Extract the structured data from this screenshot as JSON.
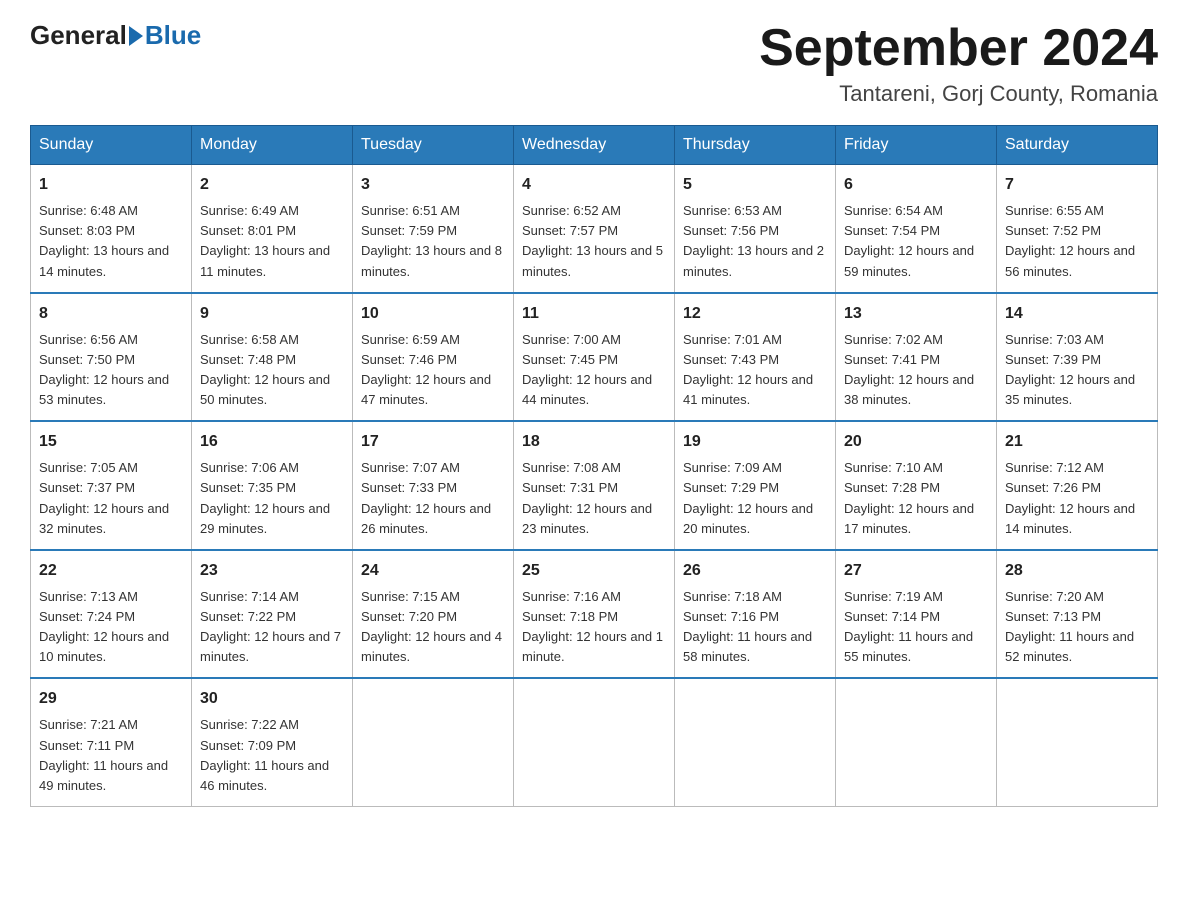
{
  "logo": {
    "general": "General",
    "blue": "Blue"
  },
  "title": "September 2024",
  "location": "Tantareni, Gorj County, Romania",
  "days_of_week": [
    "Sunday",
    "Monday",
    "Tuesday",
    "Wednesday",
    "Thursday",
    "Friday",
    "Saturday"
  ],
  "weeks": [
    [
      {
        "day": "1",
        "sunrise": "6:48 AM",
        "sunset": "8:03 PM",
        "daylight": "13 hours and 14 minutes."
      },
      {
        "day": "2",
        "sunrise": "6:49 AM",
        "sunset": "8:01 PM",
        "daylight": "13 hours and 11 minutes."
      },
      {
        "day": "3",
        "sunrise": "6:51 AM",
        "sunset": "7:59 PM",
        "daylight": "13 hours and 8 minutes."
      },
      {
        "day": "4",
        "sunrise": "6:52 AM",
        "sunset": "7:57 PM",
        "daylight": "13 hours and 5 minutes."
      },
      {
        "day": "5",
        "sunrise": "6:53 AM",
        "sunset": "7:56 PM",
        "daylight": "13 hours and 2 minutes."
      },
      {
        "day": "6",
        "sunrise": "6:54 AM",
        "sunset": "7:54 PM",
        "daylight": "12 hours and 59 minutes."
      },
      {
        "day": "7",
        "sunrise": "6:55 AM",
        "sunset": "7:52 PM",
        "daylight": "12 hours and 56 minutes."
      }
    ],
    [
      {
        "day": "8",
        "sunrise": "6:56 AM",
        "sunset": "7:50 PM",
        "daylight": "12 hours and 53 minutes."
      },
      {
        "day": "9",
        "sunrise": "6:58 AM",
        "sunset": "7:48 PM",
        "daylight": "12 hours and 50 minutes."
      },
      {
        "day": "10",
        "sunrise": "6:59 AM",
        "sunset": "7:46 PM",
        "daylight": "12 hours and 47 minutes."
      },
      {
        "day": "11",
        "sunrise": "7:00 AM",
        "sunset": "7:45 PM",
        "daylight": "12 hours and 44 minutes."
      },
      {
        "day": "12",
        "sunrise": "7:01 AM",
        "sunset": "7:43 PM",
        "daylight": "12 hours and 41 minutes."
      },
      {
        "day": "13",
        "sunrise": "7:02 AM",
        "sunset": "7:41 PM",
        "daylight": "12 hours and 38 minutes."
      },
      {
        "day": "14",
        "sunrise": "7:03 AM",
        "sunset": "7:39 PM",
        "daylight": "12 hours and 35 minutes."
      }
    ],
    [
      {
        "day": "15",
        "sunrise": "7:05 AM",
        "sunset": "7:37 PM",
        "daylight": "12 hours and 32 minutes."
      },
      {
        "day": "16",
        "sunrise": "7:06 AM",
        "sunset": "7:35 PM",
        "daylight": "12 hours and 29 minutes."
      },
      {
        "day": "17",
        "sunrise": "7:07 AM",
        "sunset": "7:33 PM",
        "daylight": "12 hours and 26 minutes."
      },
      {
        "day": "18",
        "sunrise": "7:08 AM",
        "sunset": "7:31 PM",
        "daylight": "12 hours and 23 minutes."
      },
      {
        "day": "19",
        "sunrise": "7:09 AM",
        "sunset": "7:29 PM",
        "daylight": "12 hours and 20 minutes."
      },
      {
        "day": "20",
        "sunrise": "7:10 AM",
        "sunset": "7:28 PM",
        "daylight": "12 hours and 17 minutes."
      },
      {
        "day": "21",
        "sunrise": "7:12 AM",
        "sunset": "7:26 PM",
        "daylight": "12 hours and 14 minutes."
      }
    ],
    [
      {
        "day": "22",
        "sunrise": "7:13 AM",
        "sunset": "7:24 PM",
        "daylight": "12 hours and 10 minutes."
      },
      {
        "day": "23",
        "sunrise": "7:14 AM",
        "sunset": "7:22 PM",
        "daylight": "12 hours and 7 minutes."
      },
      {
        "day": "24",
        "sunrise": "7:15 AM",
        "sunset": "7:20 PM",
        "daylight": "12 hours and 4 minutes."
      },
      {
        "day": "25",
        "sunrise": "7:16 AM",
        "sunset": "7:18 PM",
        "daylight": "12 hours and 1 minute."
      },
      {
        "day": "26",
        "sunrise": "7:18 AM",
        "sunset": "7:16 PM",
        "daylight": "11 hours and 58 minutes."
      },
      {
        "day": "27",
        "sunrise": "7:19 AM",
        "sunset": "7:14 PM",
        "daylight": "11 hours and 55 minutes."
      },
      {
        "day": "28",
        "sunrise": "7:20 AM",
        "sunset": "7:13 PM",
        "daylight": "11 hours and 52 minutes."
      }
    ],
    [
      {
        "day": "29",
        "sunrise": "7:21 AM",
        "sunset": "7:11 PM",
        "daylight": "11 hours and 49 minutes."
      },
      {
        "day": "30",
        "sunrise": "7:22 AM",
        "sunset": "7:09 PM",
        "daylight": "11 hours and 46 minutes."
      },
      null,
      null,
      null,
      null,
      null
    ]
  ]
}
